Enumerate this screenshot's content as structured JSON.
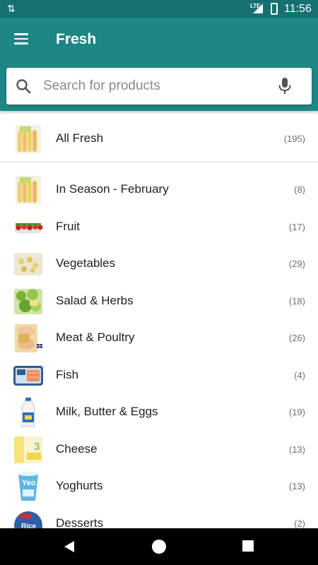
{
  "status_bar": {
    "network": "LTE",
    "time": "11:56"
  },
  "toolbar": {
    "title": "Fresh"
  },
  "search": {
    "placeholder": "Search for products",
    "value": ""
  },
  "top_item": {
    "label": "All Fresh",
    "count": "(195)"
  },
  "categories": [
    {
      "label": "In Season - February",
      "count": "(8)"
    },
    {
      "label": "Fruit",
      "count": "(17)"
    },
    {
      "label": "Vegetables",
      "count": "(29)"
    },
    {
      "label": "Salad & Herbs",
      "count": "(18)"
    },
    {
      "label": "Meat & Poultry",
      "count": "(26)"
    },
    {
      "label": "Fish",
      "count": "(4)"
    },
    {
      "label": "Milk, Butter & Eggs",
      "count": "(19)"
    },
    {
      "label": "Cheese",
      "count": "(13)"
    },
    {
      "label": "Yoghurts",
      "count": "(13)"
    },
    {
      "label": "Desserts",
      "count": "(2)"
    }
  ],
  "thumb_text": {
    "cheese": "3",
    "yoghurt": "Yeo",
    "dessert": "Rice"
  },
  "colors": {
    "status_bar": "#15716f",
    "toolbar": "#1e8684",
    "text_primary": "#212121",
    "text_secondary": "#6f6f6f",
    "divider": "#d9d9d9"
  },
  "icons": {
    "menu": "menu-icon",
    "search": "search-icon",
    "mic": "mic-icon",
    "back": "back-icon",
    "home": "home-icon",
    "recent": "recent-apps-icon"
  }
}
